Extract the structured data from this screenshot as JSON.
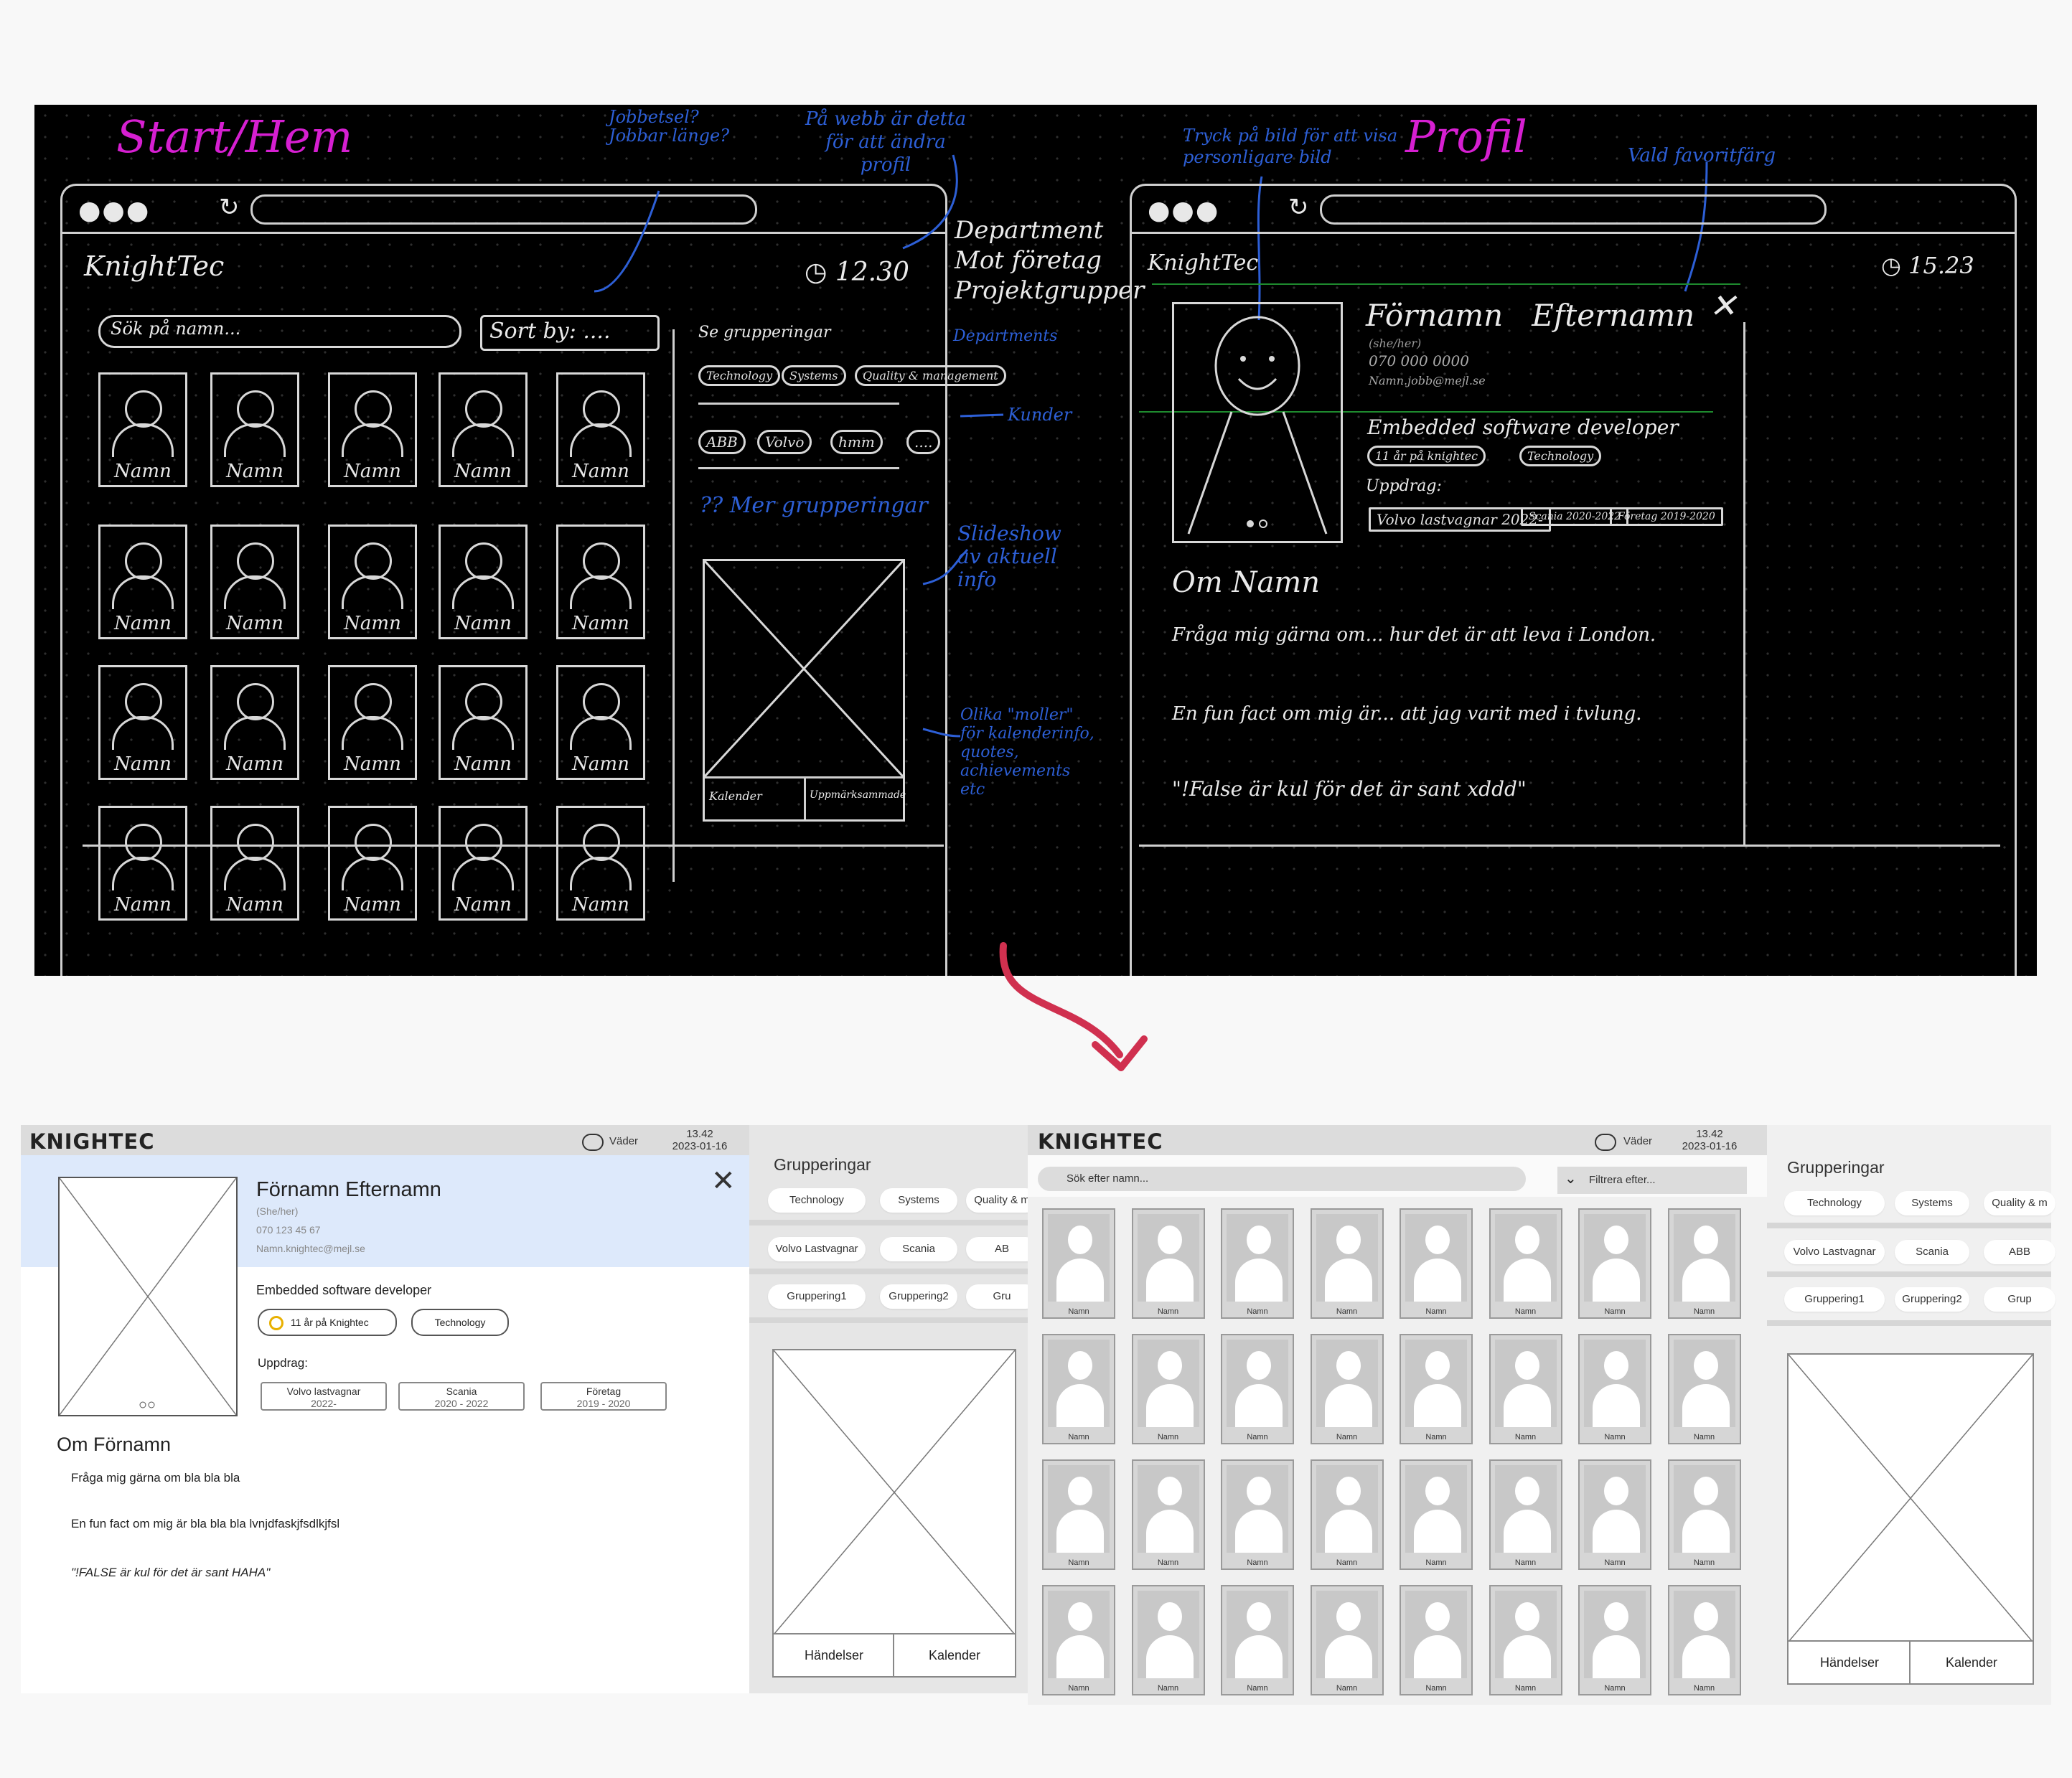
{
  "sketch": {
    "start_title": "Start/Hem",
    "profile_title": "Profil",
    "left_logo": "KnightTec",
    "left_time": "12.30",
    "right_logo": "KnightTec",
    "right_time": "15.23",
    "search_placeholder": "Sök på namn...",
    "sort_label": "Sort by: ....",
    "groups_heading": "Se grupperingar",
    "group_chips": [
      "Technology",
      "Systems",
      "Quality & management"
    ],
    "customer_chips": [
      "ABB",
      "Volvo",
      "hmm",
      "...."
    ],
    "more_groups": "?? Mer grupperingar",
    "slide_tabs": [
      "Kalender",
      "Uppmärksammade"
    ],
    "card_name": "Namn",
    "notes": {
      "jobbetsel": "Jobbetsel? Jobbar länge?",
      "webb": "På webb är detta för att ändra profil",
      "department": "Department\nMot företag\nProjektgrupper",
      "departments": "Departments",
      "kunder": "Kunder",
      "slideshow": "Slideshow av aktuell info",
      "olika": "Olika \"moller\" för kalenderinfo, quotes, achievements etc",
      "tryck": "Tryck på bild för att visa personligare bild",
      "vald": "Vald favoritfärg"
    },
    "profile": {
      "name": "Förnamn   Efternamn",
      "pronoun": "(she/her)",
      "phone": "070 000 0000",
      "email": "Namn.jobb@mejl.se",
      "role": "Embedded software developer",
      "badge": "11 år på knightec",
      "tag": "Technology",
      "uppdrag": "Uppdrag:",
      "assignments": [
        "Volvo lastvagnar 2022-",
        "Scania 2020-2022",
        "Företag 2019-2020"
      ],
      "about_title": "Om Namn",
      "about_1": "Fråga mig gärna om... hur det är att leva i London.",
      "about_2": "En fun fact om mig är... att jag varit med i tvlung.",
      "about_3": "\"!False är kul för det är sant xddd\""
    }
  },
  "wireframe_profile": {
    "logo": "KNIGHTEC",
    "weather": "Väder",
    "time": "13.42",
    "date": "2023-01-16",
    "name": "Förnamn Efternamn",
    "pronoun": "(She/her)",
    "phone": "070 123 45 67",
    "email": "Namn.knightec@mejl.se",
    "role": "Embedded software developer",
    "badge": "11 år på Knightec",
    "tag": "Technology",
    "uppdrag_label": "Uppdrag:",
    "assignments": [
      {
        "name": "Volvo lastvagnar",
        "years": "2022-"
      },
      {
        "name": "Scania",
        "years": "2020 - 2022"
      },
      {
        "name": "Företag",
        "years": "2019 - 2020"
      }
    ],
    "about_title": "Om Förnamn",
    "about_1": "Fråga mig gärna om bla bla bla",
    "about_2": "En fun fact om mig är bla bla bla lvnjdfaskjfsdlkjfsl",
    "about_3": "\"!FALSE är kul för det är sant HAHA\""
  },
  "sidebar_left": {
    "title": "Grupperingar",
    "row1": [
      "Technology",
      "Systems",
      "Quality & m"
    ],
    "row2": [
      "Volvo Lastvagnar",
      "Scania",
      "AB"
    ],
    "row3": [
      "Gruppering1",
      "Gruppering2",
      "Gru"
    ],
    "tabs": [
      "Händelser",
      "Kalender"
    ]
  },
  "wireframe_home": {
    "logo": "KNIGHTEC",
    "weather": "Väder",
    "time": "13.42",
    "date": "2023-01-16",
    "search_placeholder": "Sök efter namn...",
    "filter_label": "Filtrera efter...",
    "card_name": "Namn"
  },
  "sidebar_right": {
    "title": "Grupperingar",
    "row1": [
      "Technology",
      "Systems",
      "Quality & m"
    ],
    "row2": [
      "Volvo Lastvagnar",
      "Scania",
      "ABB"
    ],
    "row3": [
      "Gruppering1",
      "Gruppering2",
      "Grup"
    ],
    "tabs": [
      "Händelser",
      "Kalender"
    ]
  },
  "colors": {
    "sketch_bg": "#000000",
    "title_magenta": "#d61fd1",
    "note_blue": "#2d5fd6",
    "arrow_red": "#d0304f",
    "profile_header_blue": "#dde9fb",
    "wire_gray": "#dcdcdc",
    "badge_yellow": "#e8b000"
  }
}
